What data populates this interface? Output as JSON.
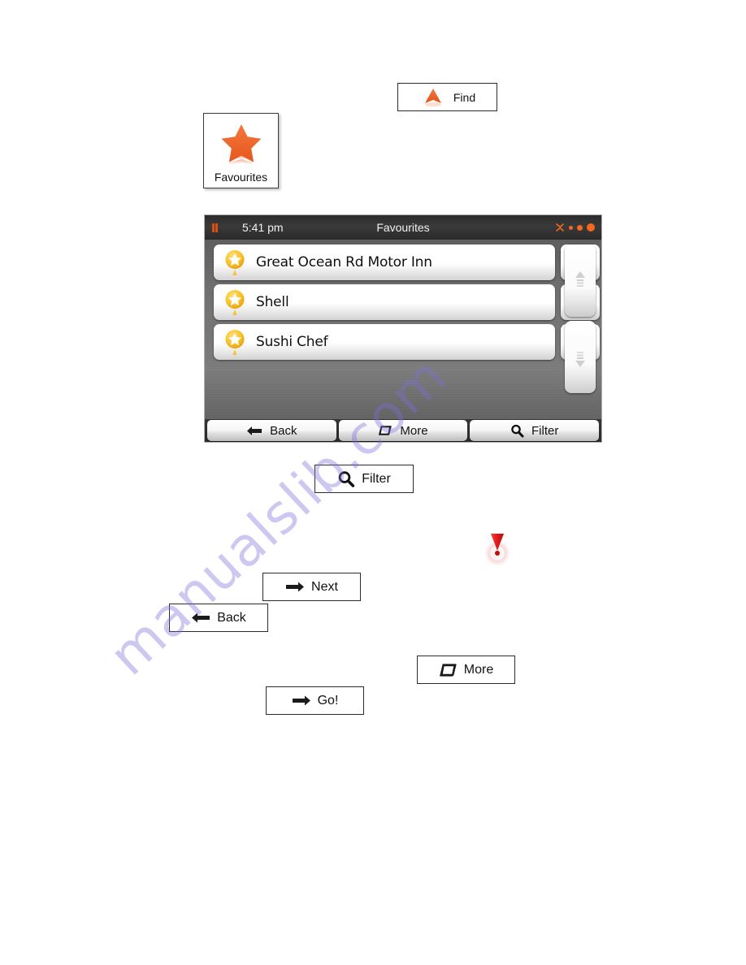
{
  "page": {
    "watermark": "manualslib.com"
  },
  "callouts": {
    "find": {
      "label": "Find",
      "icon": "find-cone-icon"
    },
    "favourites": {
      "label": "Favourites",
      "icon": "orange-star-icon"
    },
    "filter": {
      "label": "Filter",
      "icon": "magnifier-icon"
    },
    "next": {
      "label": "Next",
      "icon": "arrow-right-icon"
    },
    "back": {
      "label": "Back",
      "icon": "arrow-left-icon"
    },
    "more": {
      "label": "More",
      "icon": "rounded-square-icon"
    },
    "go": {
      "label": "Go!",
      "icon": "arrow-right-icon"
    },
    "cursor_marker": {
      "icon": "red-destination-marker-icon"
    }
  },
  "device": {
    "statusbar": {
      "time": "5:41 pm",
      "title": "Favourites",
      "battery_icon": "battery-icon",
      "gps_icon": "satellite-icon",
      "signal_dots": 3
    },
    "list": {
      "rows": [
        {
          "label": "Great Ocean Rd Motor Inn",
          "pin_icon": "favourite-star-pin-icon",
          "action_icon": "info-building-icon"
        },
        {
          "label": "Shell",
          "pin_icon": "favourite-star-pin-icon",
          "action_icon": "info-building-icon"
        },
        {
          "label": "Sushi Chef",
          "pin_icon": "favourite-star-pin-icon",
          "action_icon": "info-building-icon"
        }
      ]
    },
    "scroll": {
      "up_icon": "scroll-up-icon",
      "down_icon": "scroll-down-icon"
    },
    "toolbar": {
      "back": {
        "label": "Back",
        "icon": "arrow-left-icon"
      },
      "more": {
        "label": "More",
        "icon": "rounded-square-icon"
      },
      "filter": {
        "label": "Filter",
        "icon": "magnifier-icon"
      }
    }
  },
  "colors": {
    "accent_orange": "#f4691d",
    "star_gold": "#f7bf21",
    "marker_red": "#e51b1b",
    "watermark_purple": "#786edc",
    "device_dark": "#2b2b2b"
  }
}
